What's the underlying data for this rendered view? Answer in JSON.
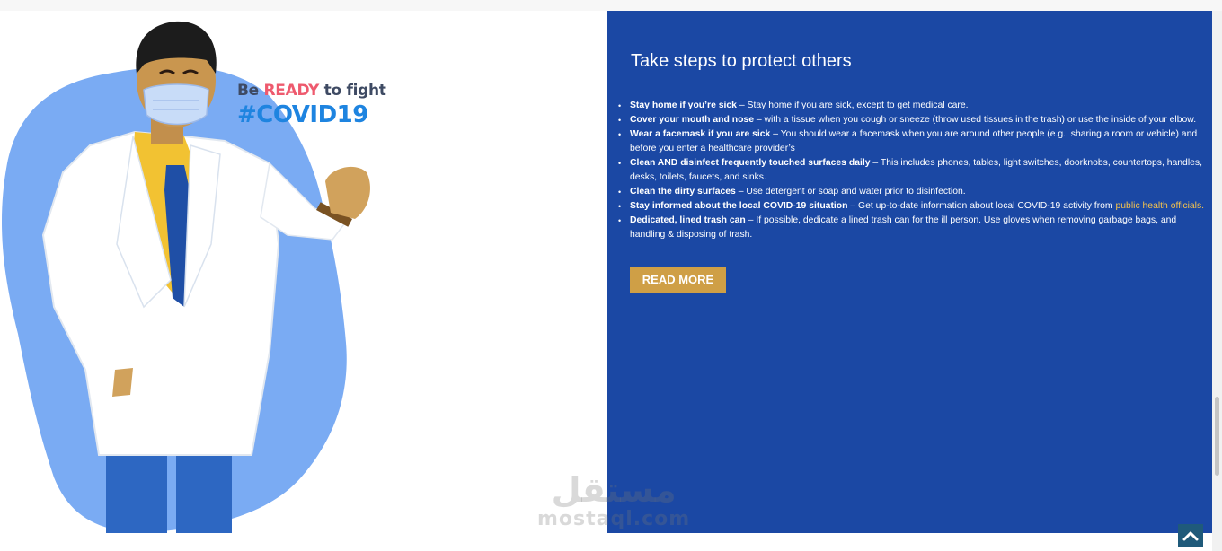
{
  "slogan": {
    "line1_before": "Be ",
    "line1_highlight": "READY",
    "line1_after": " to fight",
    "hashtag": "#COVID19"
  },
  "panel": {
    "title": "Take steps to protect others",
    "items": [
      {
        "bold": "Stay home if you’re sick",
        "text": " – Stay home if you are sick, except to get medical care."
      },
      {
        "bold": "Cover your mouth and nose",
        "text": " – with a tissue when you cough or sneeze (throw used tissues in the trash) or use the inside of your elbow."
      },
      {
        "bold": "Wear a facemask if you are sick",
        "text": " – You should wear a facemask when you are around other people (e.g., sharing a room or vehicle) and before you enter a healthcare provider’s"
      },
      {
        "bold": "Clean AND disinfect frequently touched surfaces daily",
        "text": " – This includes phones, tables, light switches, doorknobs, countertops, handles, desks, toilets, faucets, and sinks."
      },
      {
        "bold": "Clean the dirty surfaces",
        "text": " – Use detergent or soap and water prior to disinfection."
      },
      {
        "bold": "Stay informed about the local COVID-19 situation",
        "text": " – Get up-to-date information about local COVID-19 activity from ",
        "link": "public health officials."
      },
      {
        "bold": "Dedicated, lined trash can",
        "text": " – If possible, dedicate a lined trash can for the ill person. Use gloves when removing garbage bags, and handling & disposing of trash."
      }
    ],
    "read_more": "READ MORE"
  },
  "watermark": {
    "arabic": "مستقل",
    "latin": "mostaql.com"
  },
  "colors": {
    "panel_bg": "#1b48a4",
    "button": "#cf9f46",
    "link": "#f4c24d",
    "highlight": "#ee5a6e",
    "hashtag": "#1e84e0"
  },
  "icons": {
    "illustration": "doctor-with-mask-illustration",
    "back_to_top": "chevron-up-icon"
  }
}
